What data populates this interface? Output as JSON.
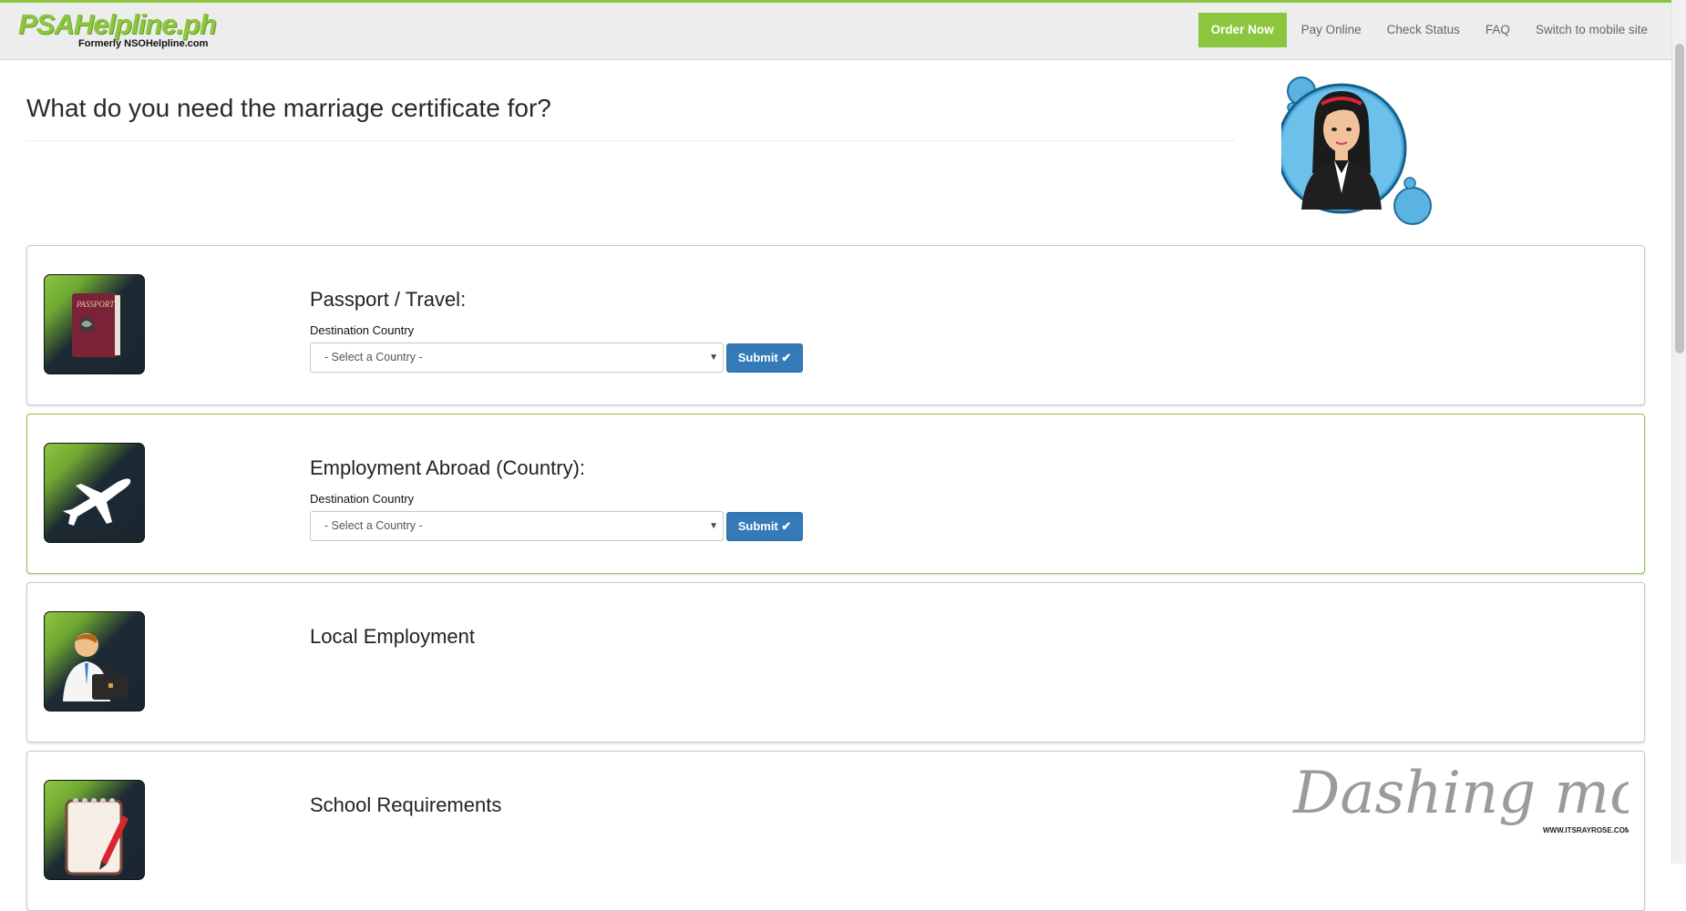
{
  "header": {
    "logo_main": "PSAHelpline.ph",
    "logo_sub": "Formerly NSOHelpline.com",
    "nav": [
      {
        "label": "Order Now",
        "id": "order"
      },
      {
        "label": "Pay Online",
        "id": "pay"
      },
      {
        "label": "Check Status",
        "id": "status"
      },
      {
        "label": "FAQ",
        "id": "faq"
      },
      {
        "label": "Switch to mobile site",
        "id": "mobile"
      }
    ],
    "accent_color": "#8cc63f"
  },
  "page": {
    "heading": "What do you need the marriage certificate for?"
  },
  "cards": [
    {
      "title": "Passport / Travel:",
      "icon": "passport-icon",
      "field_label": "Destination Country",
      "select_value": "- Select a Country -",
      "submit_label": "Submit"
    },
    {
      "title": "Employment Abroad (Country):",
      "icon": "airplane-icon",
      "field_label": "Destination Country",
      "select_value": "- Select a Country -",
      "submit_label": "Submit"
    },
    {
      "title": "Local Employment",
      "icon": "businessman-icon"
    },
    {
      "title": "School Requirements",
      "icon": "notepad-icon"
    }
  ],
  "watermark": {
    "text": "Dashing mom",
    "url_text": "WWW.ITSRAYROSE.COM"
  },
  "colors": {
    "submit_blue": "#337ab7",
    "green": "#8cc63f"
  }
}
